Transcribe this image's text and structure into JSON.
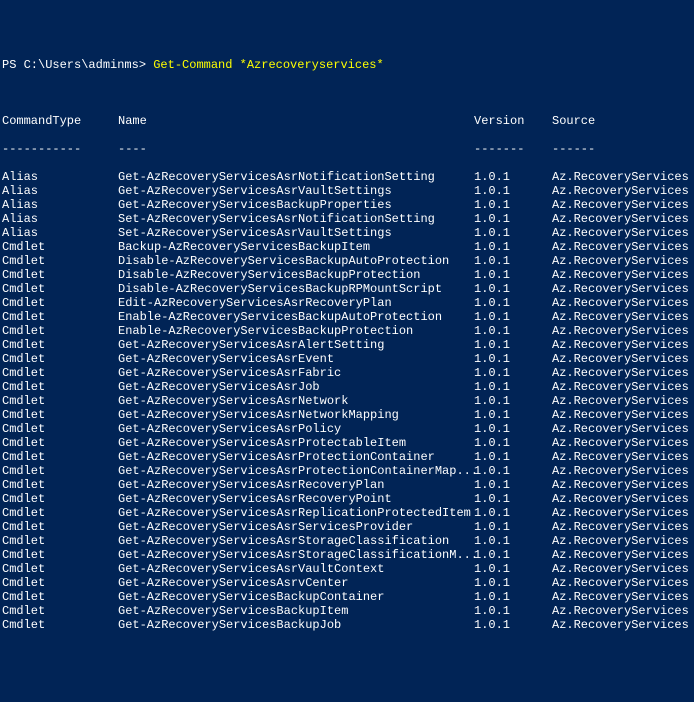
{
  "prompt": {
    "prefix": "PS C:\\Users\\adminms> ",
    "command": "Get-Command *Azrecoveryservices*"
  },
  "headers": {
    "commandType": "CommandType",
    "name": "Name",
    "version": "Version",
    "source": "Source"
  },
  "separators": {
    "commandType": "-----------",
    "name": "----",
    "version": "-------",
    "source": "------"
  },
  "rows": [
    {
      "type": "Alias",
      "name": "Get-AzRecoveryServicesAsrNotificationSetting",
      "version": "1.0.1",
      "source": "Az.RecoveryServices"
    },
    {
      "type": "Alias",
      "name": "Get-AzRecoveryServicesAsrVaultSettings",
      "version": "1.0.1",
      "source": "Az.RecoveryServices"
    },
    {
      "type": "Alias",
      "name": "Get-AzRecoveryServicesBackupProperties",
      "version": "1.0.1",
      "source": "Az.RecoveryServices"
    },
    {
      "type": "Alias",
      "name": "Set-AzRecoveryServicesAsrNotificationSetting",
      "version": "1.0.1",
      "source": "Az.RecoveryServices"
    },
    {
      "type": "Alias",
      "name": "Set-AzRecoveryServicesAsrVaultSettings",
      "version": "1.0.1",
      "source": "Az.RecoveryServices"
    },
    {
      "type": "Cmdlet",
      "name": "Backup-AzRecoveryServicesBackupItem",
      "version": "1.0.1",
      "source": "Az.RecoveryServices"
    },
    {
      "type": "Cmdlet",
      "name": "Disable-AzRecoveryServicesBackupAutoProtection",
      "version": "1.0.1",
      "source": "Az.RecoveryServices"
    },
    {
      "type": "Cmdlet",
      "name": "Disable-AzRecoveryServicesBackupProtection",
      "version": "1.0.1",
      "source": "Az.RecoveryServices"
    },
    {
      "type": "Cmdlet",
      "name": "Disable-AzRecoveryServicesBackupRPMountScript",
      "version": "1.0.1",
      "source": "Az.RecoveryServices"
    },
    {
      "type": "Cmdlet",
      "name": "Edit-AzRecoveryServicesAsrRecoveryPlan",
      "version": "1.0.1",
      "source": "Az.RecoveryServices"
    },
    {
      "type": "Cmdlet",
      "name": "Enable-AzRecoveryServicesBackupAutoProtection",
      "version": "1.0.1",
      "source": "Az.RecoveryServices"
    },
    {
      "type": "Cmdlet",
      "name": "Enable-AzRecoveryServicesBackupProtection",
      "version": "1.0.1",
      "source": "Az.RecoveryServices"
    },
    {
      "type": "Cmdlet",
      "name": "Get-AzRecoveryServicesAsrAlertSetting",
      "version": "1.0.1",
      "source": "Az.RecoveryServices"
    },
    {
      "type": "Cmdlet",
      "name": "Get-AzRecoveryServicesAsrEvent",
      "version": "1.0.1",
      "source": "Az.RecoveryServices"
    },
    {
      "type": "Cmdlet",
      "name": "Get-AzRecoveryServicesAsrFabric",
      "version": "1.0.1",
      "source": "Az.RecoveryServices"
    },
    {
      "type": "Cmdlet",
      "name": "Get-AzRecoveryServicesAsrJob",
      "version": "1.0.1",
      "source": "Az.RecoveryServices"
    },
    {
      "type": "Cmdlet",
      "name": "Get-AzRecoveryServicesAsrNetwork",
      "version": "1.0.1",
      "source": "Az.RecoveryServices"
    },
    {
      "type": "Cmdlet",
      "name": "Get-AzRecoveryServicesAsrNetworkMapping",
      "version": "1.0.1",
      "source": "Az.RecoveryServices"
    },
    {
      "type": "Cmdlet",
      "name": "Get-AzRecoveryServicesAsrPolicy",
      "version": "1.0.1",
      "source": "Az.RecoveryServices"
    },
    {
      "type": "Cmdlet",
      "name": "Get-AzRecoveryServicesAsrProtectableItem",
      "version": "1.0.1",
      "source": "Az.RecoveryServices"
    },
    {
      "type": "Cmdlet",
      "name": "Get-AzRecoveryServicesAsrProtectionContainer",
      "version": "1.0.1",
      "source": "Az.RecoveryServices"
    },
    {
      "type": "Cmdlet",
      "name": "Get-AzRecoveryServicesAsrProtectionContainerMap...",
      "version": "1.0.1",
      "source": "Az.RecoveryServices"
    },
    {
      "type": "Cmdlet",
      "name": "Get-AzRecoveryServicesAsrRecoveryPlan",
      "version": "1.0.1",
      "source": "Az.RecoveryServices"
    },
    {
      "type": "Cmdlet",
      "name": "Get-AzRecoveryServicesAsrRecoveryPoint",
      "version": "1.0.1",
      "source": "Az.RecoveryServices"
    },
    {
      "type": "Cmdlet",
      "name": "Get-AzRecoveryServicesAsrReplicationProtectedItem",
      "version": "1.0.1",
      "source": "Az.RecoveryServices"
    },
    {
      "type": "Cmdlet",
      "name": "Get-AzRecoveryServicesAsrServicesProvider",
      "version": "1.0.1",
      "source": "Az.RecoveryServices"
    },
    {
      "type": "Cmdlet",
      "name": "Get-AzRecoveryServicesAsrStorageClassification",
      "version": "1.0.1",
      "source": "Az.RecoveryServices"
    },
    {
      "type": "Cmdlet",
      "name": "Get-AzRecoveryServicesAsrStorageClassificationM...",
      "version": "1.0.1",
      "source": "Az.RecoveryServices"
    },
    {
      "type": "Cmdlet",
      "name": "Get-AzRecoveryServicesAsrVaultContext",
      "version": "1.0.1",
      "source": "Az.RecoveryServices"
    },
    {
      "type": "Cmdlet",
      "name": "Get-AzRecoveryServicesAsrvCenter",
      "version": "1.0.1",
      "source": "Az.RecoveryServices"
    },
    {
      "type": "Cmdlet",
      "name": "Get-AzRecoveryServicesBackupContainer",
      "version": "1.0.1",
      "source": "Az.RecoveryServices"
    },
    {
      "type": "Cmdlet",
      "name": "Get-AzRecoveryServicesBackupItem",
      "version": "1.0.1",
      "source": "Az.RecoveryServices"
    },
    {
      "type": "Cmdlet",
      "name": "Get-AzRecoveryServicesBackupJob",
      "version": "1.0.1",
      "source": "Az.RecoveryServices"
    }
  ]
}
